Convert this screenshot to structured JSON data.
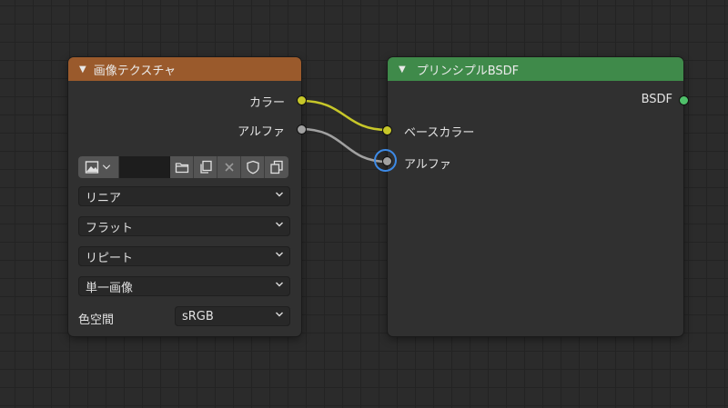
{
  "image_texture_node": {
    "title": "画像テクスチャ",
    "header_color": "#9a5a2c",
    "outputs": [
      {
        "label": "カラー",
        "socket_color": "#c7c729"
      },
      {
        "label": "アルファ",
        "socket_color": "#a1a1a1"
      }
    ],
    "image_name": "",
    "toolbar_icons": [
      "image-type-icon",
      "folder-icon",
      "duplicate-icon",
      "unlink-icon",
      "fake-user-icon",
      "copy-icon"
    ],
    "interpolation": "リニア",
    "projection": "フラット",
    "extension": "リピート",
    "source": "単一画像",
    "color_space_label": "色空間",
    "color_space": "sRGB"
  },
  "principled_node": {
    "title": "プリンシプルBSDF",
    "header_color": "#3f8a4a",
    "output": {
      "label": "BSDF",
      "socket_color": "#4fc06a"
    },
    "inputs": [
      {
        "label": "ベースカラー",
        "socket_color": "#c7c729"
      },
      {
        "label": "アルファ",
        "socket_color": "#a1a1a1"
      }
    ]
  },
  "links": [
    {
      "from": "カラー",
      "to": "ベースカラー",
      "color": "#c7c729"
    },
    {
      "from": "アルファ",
      "to": "アルファ",
      "color": "#a1a1a1"
    }
  ]
}
